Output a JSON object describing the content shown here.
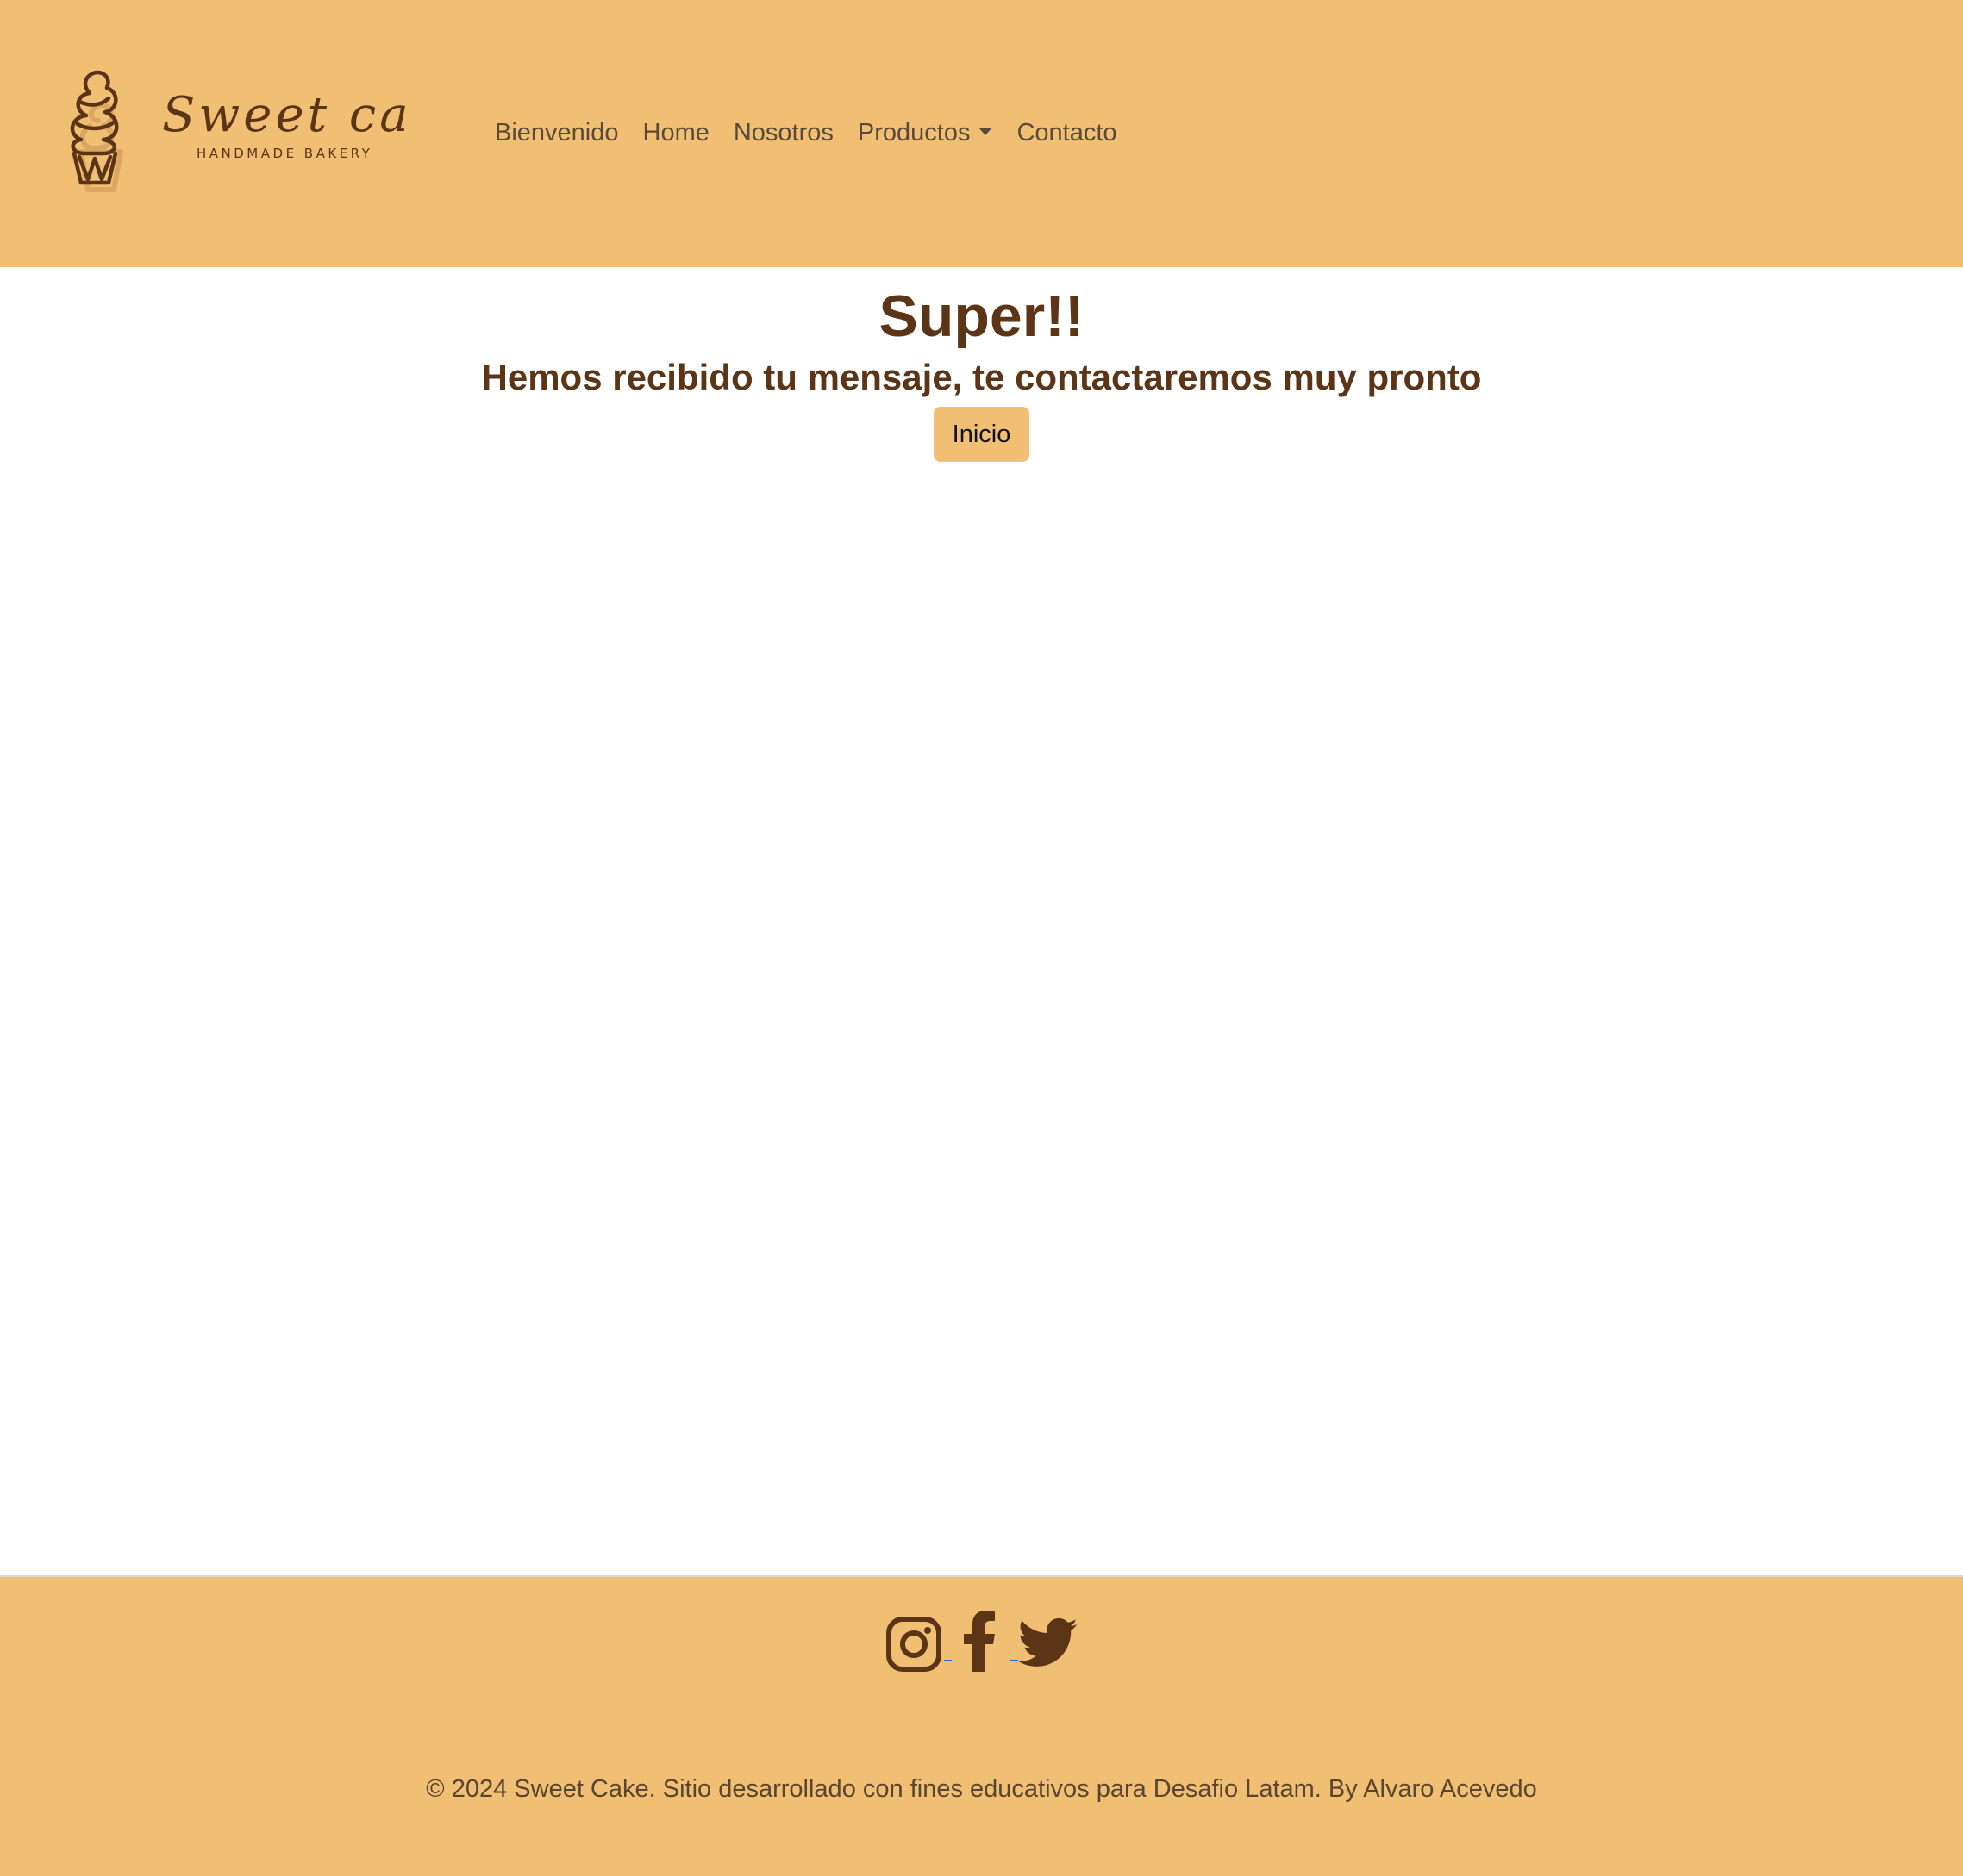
{
  "header": {
    "logo": {
      "script_text": "Sweet cake",
      "tagline": "HANDMADE BAKERY"
    },
    "nav": [
      {
        "label": "Bienvenido"
      },
      {
        "label": "Home"
      },
      {
        "label": "Nosotros"
      },
      {
        "label": "Productos",
        "dropdown": true
      },
      {
        "label": "Contacto"
      }
    ]
  },
  "main": {
    "title": "Super!!",
    "message": "Hemos recibido tu mensaje, te contactaremos muy pronto",
    "button_label": "Inicio"
  },
  "footer": {
    "social_icons": [
      "instagram-icon",
      "facebook-icon",
      "twitter-icon"
    ],
    "copyright": "© 2024 Sweet Cake. Sitio desarrollado con fines educativos para Desafio Latam. By Alvaro Acevedo"
  },
  "colors": {
    "header_bg": "#F0BF74",
    "brown": "#5C3416",
    "nav_text": "#5a4a3a"
  }
}
